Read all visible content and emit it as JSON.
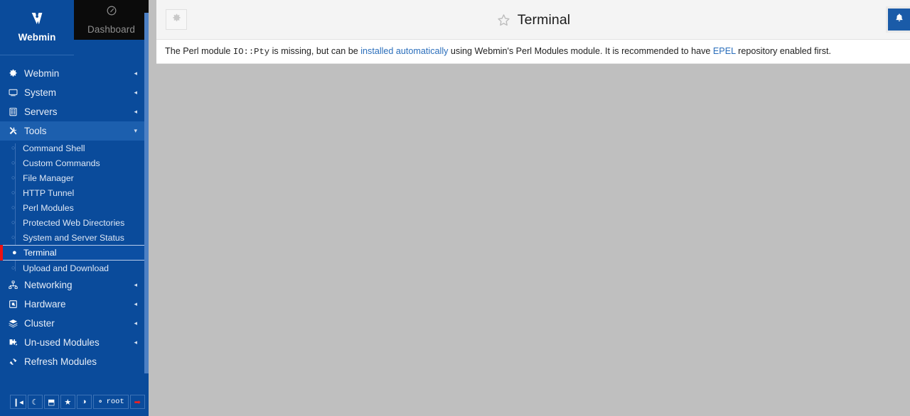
{
  "brand": {
    "webmin_label": "Webmin",
    "webmin_icon": "webmin-logo-icon",
    "dashboard_label": "Dashboard",
    "dashboard_icon": "gauge-icon"
  },
  "sidebar": {
    "items": [
      {
        "label": "Webmin",
        "icon": "gear-icon",
        "caret": "◂",
        "active": false
      },
      {
        "label": "System",
        "icon": "monitor-icon",
        "caret": "◂",
        "active": false
      },
      {
        "label": "Servers",
        "icon": "server-icon",
        "caret": "◂",
        "active": false
      },
      {
        "label": "Tools",
        "icon": "tools-icon",
        "caret": "▾",
        "active": true
      },
      {
        "label": "Networking",
        "icon": "network-icon",
        "caret": "◂",
        "active": false
      },
      {
        "label": "Hardware",
        "icon": "hardware-icon",
        "caret": "◂",
        "active": false
      },
      {
        "label": "Cluster",
        "icon": "cluster-icon",
        "caret": "◂",
        "active": false
      },
      {
        "label": "Un-used Modules",
        "icon": "puzzle-icon",
        "caret": "◂",
        "active": false
      },
      {
        "label": "Refresh Modules",
        "icon": "refresh-icon",
        "caret": "",
        "active": false
      }
    ],
    "tools_submenu": [
      {
        "label": "Command Shell",
        "selected": false
      },
      {
        "label": "Custom Commands",
        "selected": false
      },
      {
        "label": "File Manager",
        "selected": false
      },
      {
        "label": "HTTP Tunnel",
        "selected": false
      },
      {
        "label": "Perl Modules",
        "selected": false
      },
      {
        "label": "Protected Web Directories",
        "selected": false
      },
      {
        "label": "System and Server Status",
        "selected": false
      },
      {
        "label": "Terminal",
        "selected": true
      },
      {
        "label": "Upload and Download",
        "selected": false
      }
    ],
    "toolbar": [
      {
        "name": "collapse-sidebar-button",
        "glyph": "❙◂",
        "label": ""
      },
      {
        "name": "dark-mode-button",
        "glyph": "☾",
        "label": ""
      },
      {
        "name": "terminal-popup-button",
        "glyph": "⬒",
        "label": ""
      },
      {
        "name": "favorites-button",
        "glyph": "★",
        "label": ""
      },
      {
        "name": "theme-palette-button",
        "glyph": "◑",
        "label": ""
      },
      {
        "name": "user-button",
        "glyph": "⚬",
        "label": "root"
      },
      {
        "name": "logout-button",
        "glyph": "➡",
        "label": ""
      }
    ]
  },
  "header": {
    "settings_icon": "gear-icon",
    "favorite_icon": "star-outline-icon",
    "title": "Terminal",
    "notifications_icon": "bell-icon"
  },
  "main": {
    "message": {
      "part1": "The Perl module ",
      "module": "IO::Pty",
      "part2": " is missing, but can be ",
      "link1": "installed automatically",
      "part3": " using Webmin's Perl Modules module. It is recommended to have ",
      "link2": "EPEL",
      "part4": " repository enabled first."
    }
  },
  "colors": {
    "sidebar_bg": "#0a4b9b",
    "sidebar_active": "#1c5fae",
    "accent_blue": "#1a5ba8",
    "link_blue": "#2a6ebb",
    "marker_red": "#ee1111",
    "content_bg": "#bfbfbf"
  }
}
